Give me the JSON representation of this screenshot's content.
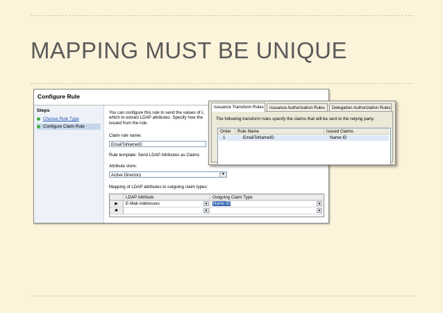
{
  "slide": {
    "title": "MAPPING MUST BE UNIQUE"
  },
  "configure_rule": {
    "title": "Configure Rule",
    "steps_title": "Steps",
    "steps": [
      {
        "label": "Choose Rule Type",
        "state": "link"
      },
      {
        "label": "Configure Claim Rule",
        "state": "selected"
      }
    ],
    "description": [
      "You can configure this rule to send the values of L",
      "which to extract LDAP attributes. Specify how the",
      "issued from the rule."
    ],
    "claim_rule_name_label": "Claim rule name:",
    "claim_rule_name_value": "EmailToNameID",
    "rule_template_text": "Rule template: Send LDAP Attributes as Claims",
    "attribute_store_label": "Attribute store:",
    "attribute_store_value": "Active Directory",
    "mapping_label": "Mapping of LDAP attributes to outgoing claim types:",
    "mapping_grid": {
      "columns": [
        "LDAP Attribute",
        "Outgoing Claim Type"
      ],
      "rows": [
        {
          "marker": "▶",
          "ldap_attribute": "E-Mail-Addresses",
          "claim_type": "Name ID"
        },
        {
          "marker": "✱",
          "ldap_attribute": "",
          "claim_type": ""
        }
      ]
    }
  },
  "issuance_rules": {
    "tabs": [
      "Issuance Transform Rules",
      "Issuance Authorization Rules",
      "Delegation Authorization Rules"
    ],
    "active_tab": "Issuance Transform Rules",
    "description": "The following transform rules specify the claims that will be sent to the relying party.",
    "columns": [
      "Order",
      "Rule Name",
      "Issued Claims"
    ],
    "rows": [
      {
        "order": "1",
        "rule_name": "EmailToNameID",
        "issued_claims": "Name ID"
      }
    ]
  },
  "colors": {
    "slide_background": "#fbf3da",
    "title_text": "#5a5a5a",
    "step_done": "#3fae3f",
    "selection_highlight": "#3363b2"
  }
}
